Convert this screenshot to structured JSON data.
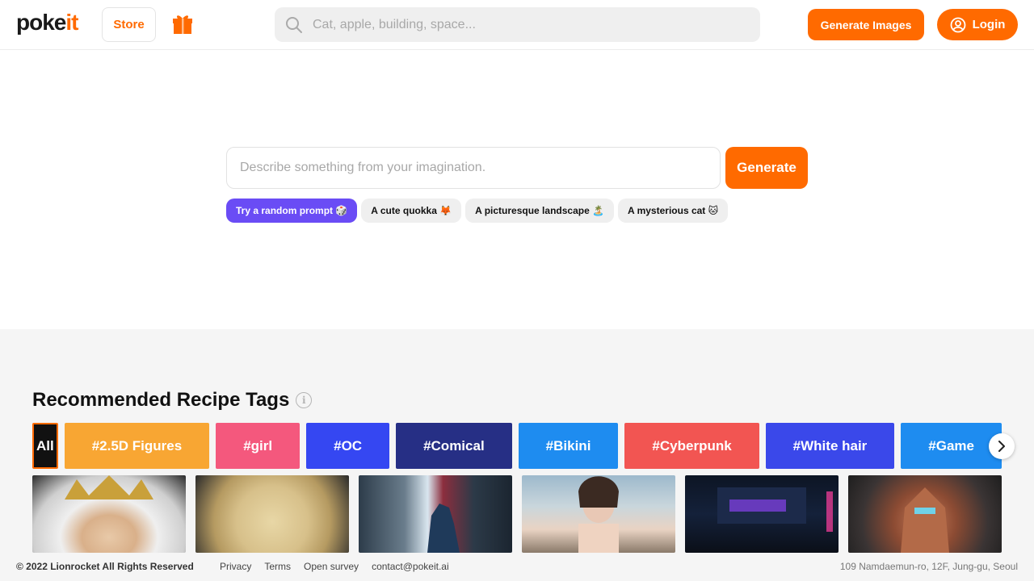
{
  "header": {
    "logo_part1": "poke",
    "logo_part2": "it",
    "store_label": "Store",
    "gift_icon": "gift-icon",
    "search_placeholder": "Cat, apple, building, space...",
    "generate_images_label": "Generate Images",
    "login_label": "Login"
  },
  "hero": {
    "prompt_placeholder": "Describe something from your imagination.",
    "generate_label": "Generate",
    "chips": [
      "Try a random prompt 🎲",
      "A cute quokka 🦊",
      "A picturesque landscape 🏝️",
      "A mysterious cat 🐱"
    ]
  },
  "recommended": {
    "title": "Recommended Recipe Tags",
    "tags": [
      {
        "label": "All",
        "color": "#111111"
      },
      {
        "label": "#2.5D Figures",
        "color": "#f8a633"
      },
      {
        "label": "#girl",
        "color": "#f4587d"
      },
      {
        "label": "#OC",
        "color": "#3547f2"
      },
      {
        "label": "#Comical",
        "color": "#262f85"
      },
      {
        "label": "#Bikini",
        "color": "#1e8cf0"
      },
      {
        "label": "#Cyberpunk",
        "color": "#f25552"
      },
      {
        "label": "#White hair",
        "color": "#3a48ea"
      },
      {
        "label": "#Game",
        "color": "#1e8cf0"
      }
    ]
  },
  "footer": {
    "copyright": "© 2022 Lionrocket All Rights Reserved",
    "links": [
      "Privacy",
      "Terms",
      "Open survey",
      "contact@pokeit.ai"
    ],
    "address": "109 Namdaemun-ro, 12F, Jung-gu, Seoul"
  },
  "colors": {
    "accent": "#ff6a00",
    "chip_primary": "#6a4cf5"
  }
}
